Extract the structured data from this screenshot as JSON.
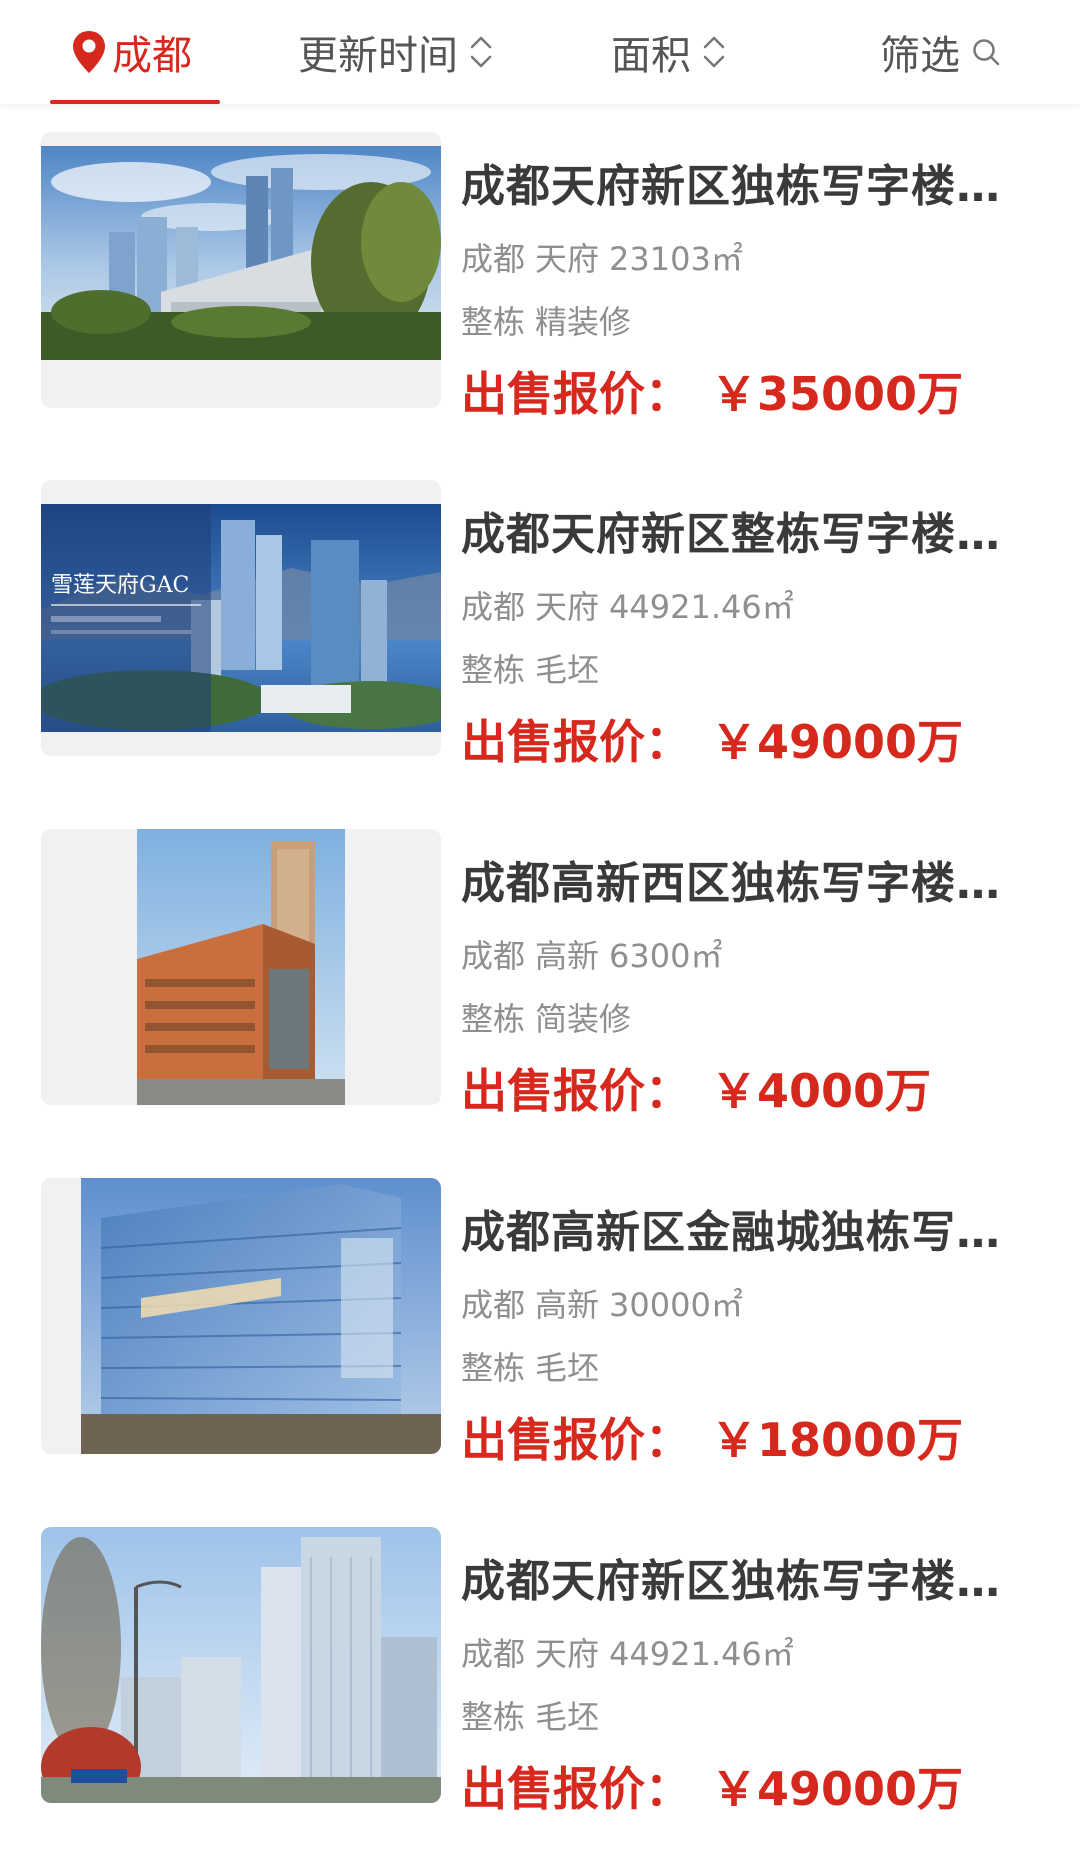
{
  "filter_bar": {
    "city": "成都",
    "update_time": "更新时间",
    "area": "面积",
    "filter": "筛选"
  },
  "colors": {
    "accent": "#d7281e",
    "title": "#3a3a3a",
    "meta": "#8f8f8f"
  },
  "listings": [
    {
      "title": "成都天府新区独栋写字楼…",
      "city": "成都",
      "district": "天府",
      "area": "23103㎡",
      "type": "整栋",
      "decoration": "精装修",
      "price_label": "出售报价：",
      "price": "￥35000万",
      "photo_caption": ""
    },
    {
      "title": "成都天府新区整栋写字楼…",
      "city": "成都",
      "district": "天府",
      "area": "44921.46㎡",
      "type": "整栋",
      "decoration": "毛坯",
      "price_label": "出售报价：",
      "price": "￥49000万",
      "photo_caption": "雪莲天府GAC"
    },
    {
      "title": "成都高新西区独栋写字楼…",
      "city": "成都",
      "district": "高新",
      "area": "6300㎡",
      "type": "整栋",
      "decoration": "简装修",
      "price_label": "出售报价：",
      "price": "￥4000万",
      "photo_caption": ""
    },
    {
      "title": "成都高新区金融城独栋写…",
      "city": "成都",
      "district": "高新",
      "area": "30000㎡",
      "type": "整栋",
      "decoration": "毛坯",
      "price_label": "出售报价：",
      "price": "￥18000万",
      "photo_caption": ""
    },
    {
      "title": "成都天府新区独栋写字楼…",
      "city": "成都",
      "district": "天府",
      "area": "44921.46㎡",
      "type": "整栋",
      "decoration": "毛坯",
      "price_label": "出售报价：",
      "price": "￥49000万",
      "photo_caption": ""
    }
  ]
}
